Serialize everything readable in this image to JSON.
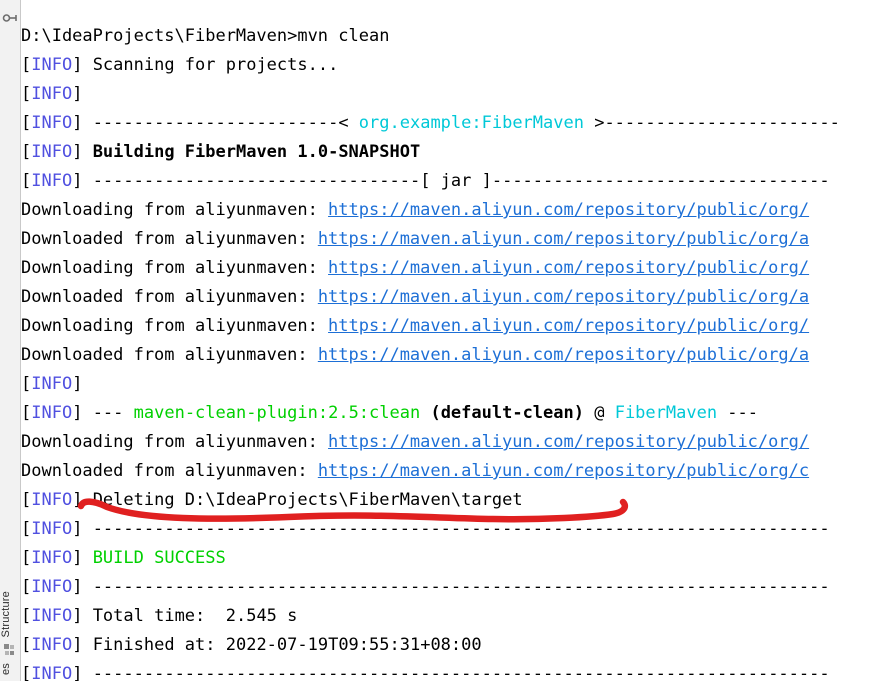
{
  "window": {
    "background": "#ffffff",
    "type": "ide-run-console"
  },
  "sidebar": {
    "top_icon": "pin-icon",
    "items": [
      {
        "label": "Structure",
        "icon": "structure-icon"
      },
      {
        "label": "es",
        "icon": "favorites-icon"
      }
    ]
  },
  "colors": {
    "info_tag": "#5050e0",
    "cyan": "#00c8d7",
    "green": "#00d000",
    "link": "#1d6fd6",
    "annotation_red": "#e02020",
    "text": "#000000",
    "background": "#ffffff"
  },
  "annotation": {
    "type": "hand-drawn-underline",
    "color": "#e02020",
    "target_line_index": 16,
    "target_text": "[INFO] Deleting D:\\IdeaProjects\\FiberMaven\\target"
  },
  "console": {
    "command_prompt": "D:\\IdeaProjects\\FiberMaven>",
    "command": "mvn clean",
    "lines": [
      {
        "id": "line-prompt",
        "spans": [
          {
            "text": "D:\\IdeaProjects\\FiberMaven>mvn clean",
            "style": "plain"
          }
        ]
      },
      {
        "id": "line-scanning",
        "spans": [
          {
            "text": "[",
            "style": "brk"
          },
          {
            "text": "INFO",
            "style": "info"
          },
          {
            "text": "] ",
            "style": "brk"
          },
          {
            "text": "Scanning for projects...",
            "style": "plain"
          }
        ]
      },
      {
        "id": "line-blank-1",
        "spans": [
          {
            "text": "[",
            "style": "brk"
          },
          {
            "text": "INFO",
            "style": "info"
          },
          {
            "text": "] ",
            "style": "brk"
          }
        ]
      },
      {
        "id": "line-sep-project",
        "spans": [
          {
            "text": "[",
            "style": "brk"
          },
          {
            "text": "INFO",
            "style": "info"
          },
          {
            "text": "] ",
            "style": "brk"
          },
          {
            "text": "------------------------< ",
            "style": "plain"
          },
          {
            "text": "org.example:FiberMaven",
            "style": "cyan"
          },
          {
            "text": " >-----------------------",
            "style": "plain"
          }
        ]
      },
      {
        "id": "line-building",
        "spans": [
          {
            "text": "[",
            "style": "brk"
          },
          {
            "text": "INFO",
            "style": "info"
          },
          {
            "text": "] ",
            "style": "brk"
          },
          {
            "text": "Building FiberMaven 1.0-SNAPSHOT",
            "style": "bold"
          }
        ]
      },
      {
        "id": "line-sep-jar",
        "spans": [
          {
            "text": "[",
            "style": "brk"
          },
          {
            "text": "INFO",
            "style": "info"
          },
          {
            "text": "] ",
            "style": "brk"
          },
          {
            "text": "--------------------------------[ jar ]---------------------------------",
            "style": "plain"
          }
        ]
      },
      {
        "id": "line-dl-1",
        "spans": [
          {
            "text": "Downloading from aliyunmaven: ",
            "style": "plain"
          },
          {
            "text": "https://maven.aliyun.com/repository/public/org/",
            "style": "link"
          }
        ]
      },
      {
        "id": "line-dl-2",
        "spans": [
          {
            "text": "Downloaded from aliyunmaven: ",
            "style": "plain"
          },
          {
            "text": "https://maven.aliyun.com/repository/public/org/a",
            "style": "link"
          }
        ]
      },
      {
        "id": "line-dl-3",
        "spans": [
          {
            "text": "Downloading from aliyunmaven: ",
            "style": "plain"
          },
          {
            "text": "https://maven.aliyun.com/repository/public/org/",
            "style": "link"
          }
        ]
      },
      {
        "id": "line-dl-4",
        "spans": [
          {
            "text": "Downloaded from aliyunmaven: ",
            "style": "plain"
          },
          {
            "text": "https://maven.aliyun.com/repository/public/org/a",
            "style": "link"
          }
        ]
      },
      {
        "id": "line-dl-5",
        "spans": [
          {
            "text": "Downloading from aliyunmaven: ",
            "style": "plain"
          },
          {
            "text": "https://maven.aliyun.com/repository/public/org/",
            "style": "link"
          }
        ]
      },
      {
        "id": "line-dl-6",
        "spans": [
          {
            "text": "Downloaded from aliyunmaven: ",
            "style": "plain"
          },
          {
            "text": "https://maven.aliyun.com/repository/public/org/a",
            "style": "link"
          }
        ]
      },
      {
        "id": "line-blank-2",
        "spans": [
          {
            "text": "[",
            "style": "brk"
          },
          {
            "text": "INFO",
            "style": "info"
          },
          {
            "text": "] ",
            "style": "brk"
          }
        ]
      },
      {
        "id": "line-plugin",
        "spans": [
          {
            "text": "[",
            "style": "brk"
          },
          {
            "text": "INFO",
            "style": "info"
          },
          {
            "text": "] ",
            "style": "brk"
          },
          {
            "text": "--- ",
            "style": "plain"
          },
          {
            "text": "maven-clean-plugin:2.5:clean",
            "style": "green"
          },
          {
            "text": " (default-clean)",
            "style": "bold"
          },
          {
            "text": " @ ",
            "style": "plain"
          },
          {
            "text": "FiberMaven",
            "style": "cyan"
          },
          {
            "text": " ---",
            "style": "plain"
          }
        ]
      },
      {
        "id": "line-dl-7",
        "spans": [
          {
            "text": "Downloading from aliyunmaven: ",
            "style": "plain"
          },
          {
            "text": "https://maven.aliyun.com/repository/public/org/",
            "style": "link"
          }
        ]
      },
      {
        "id": "line-dl-8",
        "spans": [
          {
            "text": "Downloaded from aliyunmaven: ",
            "style": "plain"
          },
          {
            "text": "https://maven.aliyun.com/repository/public/org/c",
            "style": "link"
          }
        ]
      },
      {
        "id": "line-deleting",
        "spans": [
          {
            "text": "[",
            "style": "brk"
          },
          {
            "text": "INFO",
            "style": "info"
          },
          {
            "text": "] ",
            "style": "brk"
          },
          {
            "text": "Deleting D:\\IdeaProjects\\FiberMaven\\target",
            "style": "plain"
          }
        ]
      },
      {
        "id": "line-sep-1",
        "spans": [
          {
            "text": "[",
            "style": "brk"
          },
          {
            "text": "INFO",
            "style": "info"
          },
          {
            "text": "] ",
            "style": "brk"
          },
          {
            "text": "------------------------------------------------------------------------",
            "style": "plain"
          }
        ]
      },
      {
        "id": "line-build-success",
        "spans": [
          {
            "text": "[",
            "style": "brk"
          },
          {
            "text": "INFO",
            "style": "info"
          },
          {
            "text": "] ",
            "style": "brk"
          },
          {
            "text": "BUILD SUCCESS",
            "style": "green"
          }
        ]
      },
      {
        "id": "line-sep-2",
        "spans": [
          {
            "text": "[",
            "style": "brk"
          },
          {
            "text": "INFO",
            "style": "info"
          },
          {
            "text": "] ",
            "style": "brk"
          },
          {
            "text": "------------------------------------------------------------------------",
            "style": "plain"
          }
        ]
      },
      {
        "id": "line-total-time",
        "spans": [
          {
            "text": "[",
            "style": "brk"
          },
          {
            "text": "INFO",
            "style": "info"
          },
          {
            "text": "] ",
            "style": "brk"
          },
          {
            "text": "Total time:  2.545 s",
            "style": "plain"
          }
        ]
      },
      {
        "id": "line-finished-at",
        "spans": [
          {
            "text": "[",
            "style": "brk"
          },
          {
            "text": "INFO",
            "style": "info"
          },
          {
            "text": "] ",
            "style": "brk"
          },
          {
            "text": "Finished at: 2022-07-19T09:55:31+08:00",
            "style": "plain"
          }
        ]
      },
      {
        "id": "line-sep-3",
        "spans": [
          {
            "text": "[",
            "style": "brk"
          },
          {
            "text": "INFO",
            "style": "info"
          },
          {
            "text": "] ",
            "style": "brk"
          },
          {
            "text": "------------------------------------------------------------------------",
            "style": "plain"
          }
        ]
      }
    ]
  }
}
